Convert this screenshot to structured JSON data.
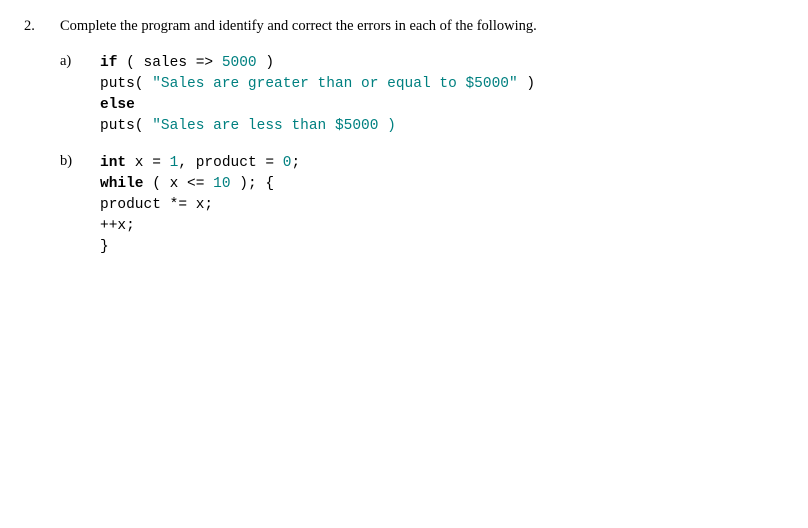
{
  "question": {
    "number": "2.",
    "prompt": "Complete the program and identify and correct the errors in each of the following."
  },
  "parts": {
    "a": {
      "label": "a)",
      "l1_kw": "if",
      "l1_rest1": " ( sales => ",
      "l1_num": "5000",
      "l1_rest2": " )",
      "l2_pre": "puts( ",
      "l2_str": "\"Sales are greater than or equal to $5000\"",
      "l2_post": " )",
      "l3_kw": "else",
      "l4_pre": "puts( ",
      "l4_str": "\"Sales are less than $5000 )"
    },
    "b": {
      "label": "b)",
      "l1_kw": "int",
      "l1_rest1": " x = ",
      "l1_n1": "1",
      "l1_rest2": ", product = ",
      "l1_n2": "0",
      "l1_rest3": ";",
      "l2_kw": "while",
      "l2_rest1": " ( x <= ",
      "l2_n": "10",
      "l2_rest2": " ); {",
      "l3": "product *= x;",
      "l4": "++x;",
      "l5": "}"
    }
  }
}
